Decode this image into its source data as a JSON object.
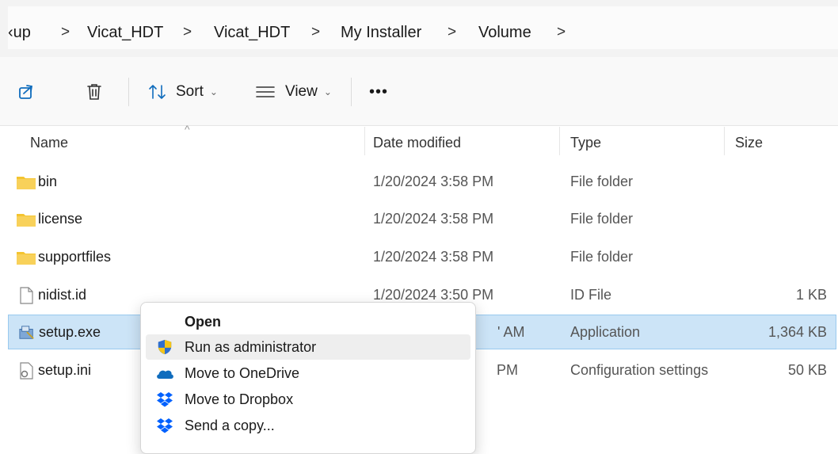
{
  "breadcrumb": {
    "items": [
      "‹up",
      "Vicat_HDT",
      "Vicat_HDT",
      "My Installer",
      "Volume"
    ],
    "separator": ">"
  },
  "toolbar": {
    "share_icon": "share-icon",
    "delete_icon": "trash-icon",
    "sort_label": "Sort",
    "view_label": "View",
    "more_label": "•••"
  },
  "columns": {
    "name": "Name",
    "date": "Date modified",
    "type": "Type",
    "size": "Size"
  },
  "files": [
    {
      "name": "bin",
      "date": "1/20/2024 3:58 PM",
      "type": "File folder",
      "size": "",
      "icon": "folder-icon"
    },
    {
      "name": "license",
      "date": "1/20/2024 3:58 PM",
      "type": "File folder",
      "size": "",
      "icon": "folder-icon"
    },
    {
      "name": "supportfiles",
      "date": "1/20/2024 3:58 PM",
      "type": "File folder",
      "size": "",
      "icon": "folder-icon"
    },
    {
      "name": "nidist.id",
      "date": "1/20/2024 3:50 PM",
      "type": "ID File",
      "size": "1 KB",
      "icon": "file-icon"
    },
    {
      "name": "setup.exe",
      "date": "' AM",
      "type": "Application",
      "size": "1,364 KB",
      "icon": "installer-icon",
      "selected": true
    },
    {
      "name": "setup.ini",
      "date": "PM",
      "type": "Configuration settings",
      "size": "50 KB",
      "icon": "config-file-icon"
    }
  ],
  "context_menu": {
    "items": [
      {
        "label": "Open",
        "icon": "",
        "bold": true
      },
      {
        "label": "Run as administrator",
        "icon": "shield-icon",
        "hover": true
      },
      {
        "label": "Move to OneDrive",
        "icon": "onedrive-icon"
      },
      {
        "label": "Move to Dropbox",
        "icon": "dropbox-icon"
      },
      {
        "label": "Send a copy...",
        "icon": "dropbox-icon"
      }
    ]
  },
  "colors": {
    "selection": "#cce4f7",
    "folder": "#f4c430",
    "onedrive": "#0f6cbd",
    "dropbox": "#0061fe"
  }
}
